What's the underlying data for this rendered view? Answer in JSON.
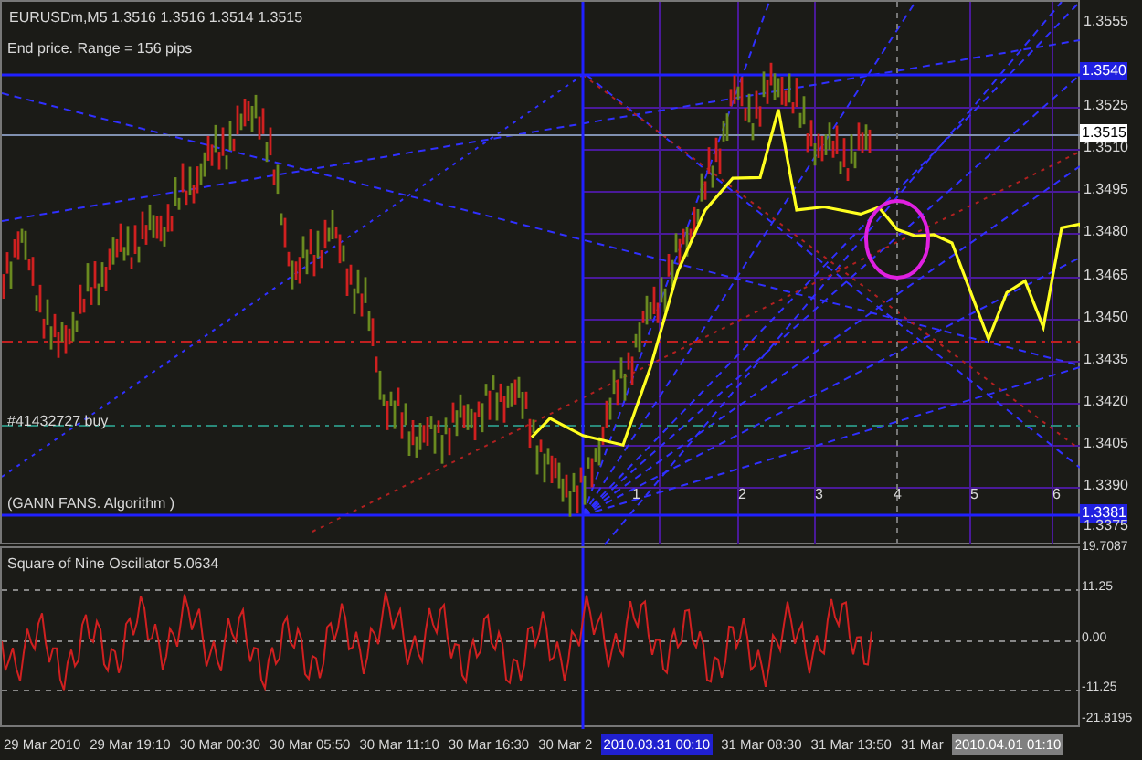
{
  "chart_header": "EURUSDm,M5  1.3516 1.3516 1.3514 1.3515",
  "objects": [
    {
      "kind": "range",
      "label": "End price. Range = 156 pips"
    },
    {
      "kind": "order",
      "label": "#41432727 buy"
    },
    {
      "kind": "fan",
      "label": "(GANN FANS. Algorithm )"
    }
  ],
  "fan_numbers": [
    "1",
    "2",
    "3",
    "4",
    "5",
    "6"
  ],
  "price_axis": [
    {
      "kind": "tick",
      "label": "1.3555"
    },
    {
      "kind": "box",
      "label": "1.3540",
      "color": "#2020e0"
    },
    {
      "kind": "tick",
      "label": "1.3525"
    },
    {
      "kind": "box",
      "label": "1.3515",
      "color": "#ffffff"
    },
    {
      "kind": "tick",
      "label": "1.3510"
    },
    {
      "kind": "tick",
      "label": "1.3495"
    },
    {
      "kind": "tick",
      "label": "1.3480"
    },
    {
      "kind": "tick",
      "label": "1.3465"
    },
    {
      "kind": "tick",
      "label": "1.3450"
    },
    {
      "kind": "tick",
      "label": "1.3435"
    },
    {
      "kind": "tick",
      "label": "1.3420"
    },
    {
      "kind": "tick",
      "label": "1.3405"
    },
    {
      "kind": "tick",
      "label": "1.3390"
    },
    {
      "kind": "box",
      "label": "1.3381",
      "color": "#2020e0"
    },
    {
      "kind": "tick",
      "label": "1.3375"
    }
  ],
  "indicator": {
    "title": "Square of Nine Oscillator 5.0634",
    "axis": [
      "19.7087",
      "11.25",
      "0.00",
      "-11.25",
      "-21.8195"
    ]
  },
  "time_axis": [
    {
      "kind": "tick",
      "label": "29 Mar 2010"
    },
    {
      "kind": "tick",
      "label": "29 Mar 19:10"
    },
    {
      "kind": "tick",
      "label": "30 Mar 00:30"
    },
    {
      "kind": "tick",
      "label": "30 Mar 05:50"
    },
    {
      "kind": "tick",
      "label": "30 Mar 11:10"
    },
    {
      "kind": "tick",
      "label": "30 Mar 16:30"
    },
    {
      "kind": "tick",
      "label": "30 Mar 2"
    },
    {
      "kind": "box",
      "label": "2010.03.31 00:10",
      "color": "#2020d0"
    },
    {
      "kind": "tick",
      "label": "31 Mar 08:30"
    },
    {
      "kind": "tick",
      "label": "31 Mar 13:50"
    },
    {
      "kind": "tick",
      "label": "31 Mar"
    },
    {
      "kind": "box",
      "label": "2010.04.01 01:10",
      "color": "#808080"
    }
  ]
}
